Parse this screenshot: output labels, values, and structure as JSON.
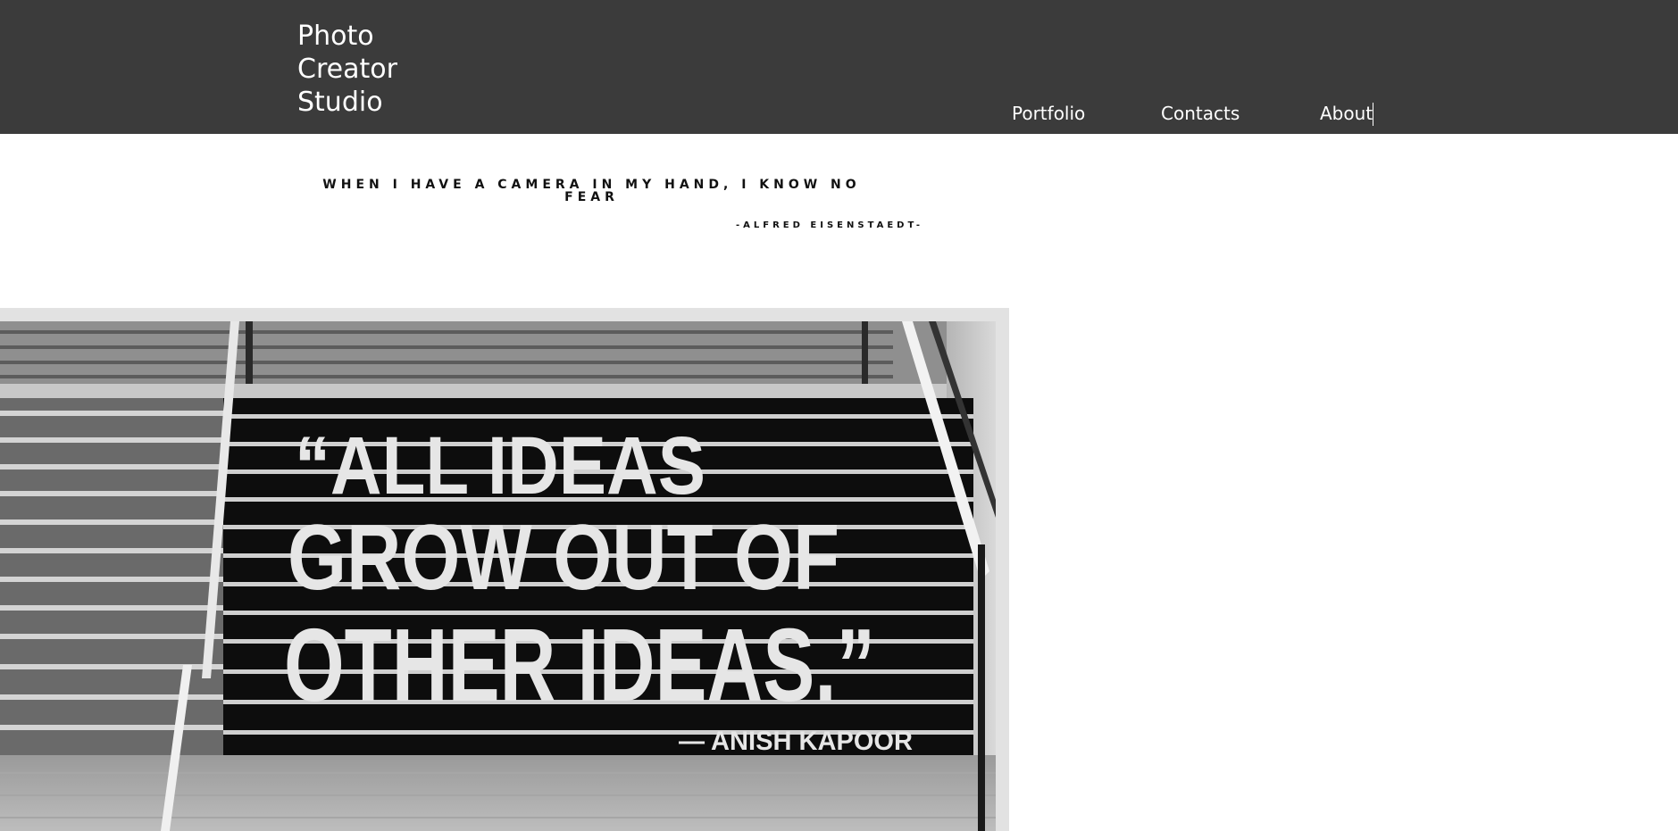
{
  "header": {
    "logo_lines": [
      "Photo",
      "Creator",
      "Studio"
    ],
    "nav": [
      {
        "label": "Portfolio"
      },
      {
        "label": "Contacts"
      },
      {
        "label": "About"
      }
    ]
  },
  "intro": {
    "quote": "WHEN I HAVE A CAMERA IN MY HAND, I KNOW NO FEAR",
    "author": "-ALFRED EISENSTAEDT-"
  },
  "hero": {
    "quote_lines": [
      "“ALL IDEAS",
      "GROW OUT OF",
      "OTHER IDEAS.”"
    ],
    "attribution": "— ANISH KAPOOR"
  },
  "colors": {
    "header_bg": "#3b3b3b",
    "header_text": "#ffffff",
    "photo_frame": "#e2e2e2"
  }
}
